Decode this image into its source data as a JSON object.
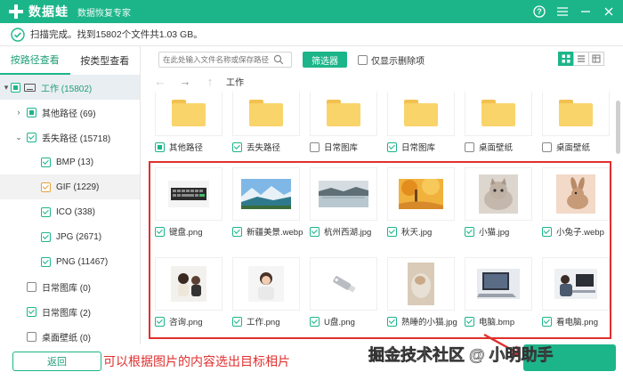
{
  "app": {
    "name": "数据蛙",
    "subtitle": "数据恢复专家",
    "accent": "#1cb58a"
  },
  "window_controls": [
    "help-icon",
    "menu-icon",
    "minimize-icon",
    "close-icon"
  ],
  "status": {
    "text": "扫描完成。找到15802个文件共1.03 GB。"
  },
  "left_panel": {
    "tabs": [
      {
        "label": "按路径查看",
        "active": true
      },
      {
        "label": "按类型查看",
        "active": false
      }
    ],
    "tree": [
      {
        "label": "工作 (15802)"
      },
      {
        "label": "其他路径 (69)"
      },
      {
        "label": "丢失路径 (15718)"
      },
      {
        "label": "BMP (13)"
      },
      {
        "label": "GIF (1229)"
      },
      {
        "label": "ICO (338)"
      },
      {
        "label": "JPG (2671)"
      },
      {
        "label": "PNG (11467)"
      },
      {
        "label": "日常图库 (0)"
      },
      {
        "label": "日常图库 (2)"
      },
      {
        "label": "桌面壁纸 (0)"
      }
    ],
    "back_label": "返回"
  },
  "toolbar": {
    "search_placeholder": "在此处输入文件名称或保存路径",
    "filter_label": "筛选器",
    "deleted_only_label": "仅显示删除项",
    "path": "工作"
  },
  "folders": [
    {
      "label": "其他路径"
    },
    {
      "label": "丢失路径"
    },
    {
      "label": "日常图库"
    },
    {
      "label": "日常图库"
    },
    {
      "label": "桌面壁纸"
    },
    {
      "label": "桌面壁纸"
    }
  ],
  "images": [
    {
      "label": "键盘.png"
    },
    {
      "label": "新疆美景.webp"
    },
    {
      "label": "杭州西湖.jpg"
    },
    {
      "label": "秋天.jpg"
    },
    {
      "label": "小猫.jpg"
    },
    {
      "label": "小兔子.webp"
    },
    {
      "label": "咨询.png"
    },
    {
      "label": "工作.png"
    },
    {
      "label": "U盘.png"
    },
    {
      "label": "熟睡的小猫.jpg"
    },
    {
      "label": "电脑.bmp"
    },
    {
      "label": "看电脑.png"
    }
  ],
  "annotation": {
    "caption": "可以根据图片的内容选出目标相片",
    "color": "#e0302f"
  },
  "watermark": "掘金技术社区 @ 小明助手"
}
